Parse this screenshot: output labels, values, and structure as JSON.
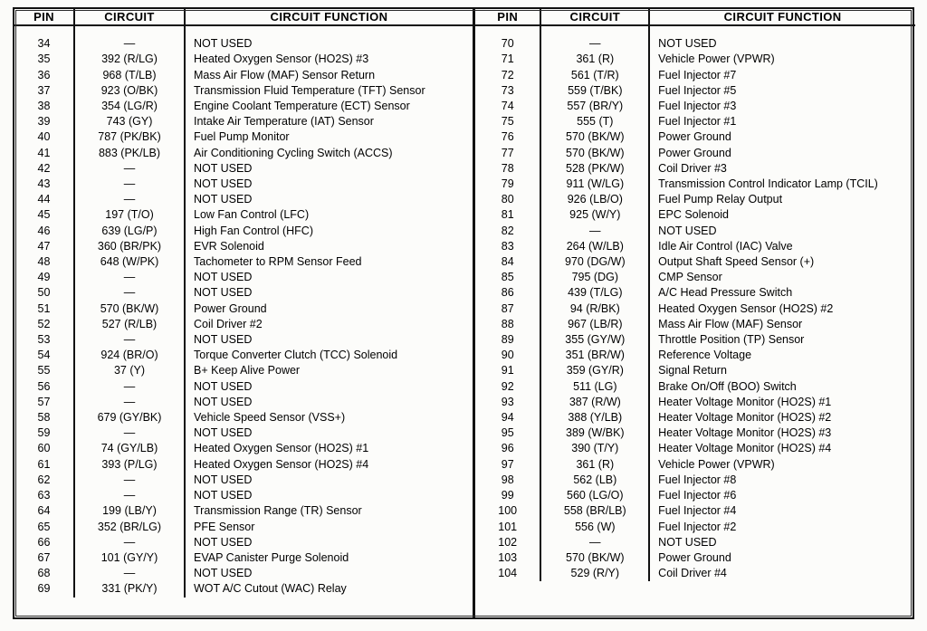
{
  "document": {
    "type": "pcm-connector-pinout-table",
    "columns": [
      "PIN",
      "CIRCUIT",
      "CIRCUIT FUNCTION"
    ],
    "not_used_label": "NOT USED",
    "empty_circuit_symbol": "—"
  },
  "left_table": {
    "headers": {
      "pin": "PIN",
      "circuit": "CIRCUIT",
      "function": "CIRCUIT FUNCTION"
    },
    "rows": [
      {
        "pin": "34",
        "circuit": "—",
        "function": "NOT USED"
      },
      {
        "pin": "35",
        "circuit": "392 (R/LG)",
        "function": "Heated Oxygen Sensor (HO2S) #3"
      },
      {
        "pin": "36",
        "circuit": "968 (T/LB)",
        "function": "Mass Air Flow (MAF) Sensor Return"
      },
      {
        "pin": "37",
        "circuit": "923 (O/BK)",
        "function": "Transmission Fluid Temperature (TFT) Sensor"
      },
      {
        "pin": "38",
        "circuit": "354 (LG/R)",
        "function": "Engine Coolant Temperature (ECT) Sensor"
      },
      {
        "pin": "39",
        "circuit": "743 (GY)",
        "function": "Intake Air Temperature (IAT) Sensor"
      },
      {
        "pin": "40",
        "circuit": "787 (PK/BK)",
        "function": "Fuel Pump Monitor"
      },
      {
        "pin": "41",
        "circuit": "883 (PK/LB)",
        "function": "Air Conditioning Cycling Switch (ACCS)"
      },
      {
        "pin": "42",
        "circuit": "—",
        "function": "NOT USED"
      },
      {
        "pin": "43",
        "circuit": "—",
        "function": "NOT USED"
      },
      {
        "pin": "44",
        "circuit": "—",
        "function": "NOT USED"
      },
      {
        "pin": "45",
        "circuit": "197 (T/O)",
        "function": "Low Fan Control (LFC)"
      },
      {
        "pin": "46",
        "circuit": "639 (LG/P)",
        "function": "High Fan Control (HFC)"
      },
      {
        "pin": "47",
        "circuit": "360 (BR/PK)",
        "function": "EVR Solenoid"
      },
      {
        "pin": "48",
        "circuit": "648 (W/PK)",
        "function": "Tachometer to RPM Sensor Feed"
      },
      {
        "pin": "49",
        "circuit": "—",
        "function": "NOT USED"
      },
      {
        "pin": "50",
        "circuit": "—",
        "function": "NOT USED"
      },
      {
        "pin": "51",
        "circuit": "570 (BK/W)",
        "function": "Power Ground"
      },
      {
        "pin": "52",
        "circuit": "527 (R/LB)",
        "function": "Coil Driver #2"
      },
      {
        "pin": "53",
        "circuit": "—",
        "function": "NOT USED"
      },
      {
        "pin": "54",
        "circuit": "924 (BR/O)",
        "function": "Torque Converter Clutch (TCC) Solenoid"
      },
      {
        "pin": "55",
        "circuit": "37 (Y)",
        "function": "B+ Keep Alive Power"
      },
      {
        "pin": "56",
        "circuit": "—",
        "function": "NOT USED"
      },
      {
        "pin": "57",
        "circuit": "—",
        "function": "NOT USED"
      },
      {
        "pin": "58",
        "circuit": "679 (GY/BK)",
        "function": "Vehicle Speed Sensor (VSS+)"
      },
      {
        "pin": "59",
        "circuit": "—",
        "function": "NOT USED"
      },
      {
        "pin": "60",
        "circuit": "74 (GY/LB)",
        "function": "Heated Oxygen Sensor (HO2S) #1"
      },
      {
        "pin": "61",
        "circuit": "393 (P/LG)",
        "function": "Heated Oxygen Sensor (HO2S) #4"
      },
      {
        "pin": "62",
        "circuit": "—",
        "function": "NOT USED"
      },
      {
        "pin": "63",
        "circuit": "—",
        "function": "NOT USED"
      },
      {
        "pin": "64",
        "circuit": "199 (LB/Y)",
        "function": "Transmission Range (TR) Sensor"
      },
      {
        "pin": "65",
        "circuit": "352 (BR/LG)",
        "function": "PFE Sensor"
      },
      {
        "pin": "66",
        "circuit": "—",
        "function": "NOT USED"
      },
      {
        "pin": "67",
        "circuit": "101 (GY/Y)",
        "function": "EVAP Canister Purge Solenoid"
      },
      {
        "pin": "68",
        "circuit": "—",
        "function": "NOT USED"
      },
      {
        "pin": "69",
        "circuit": "331 (PK/Y)",
        "function": "WOT A/C Cutout (WAC) Relay"
      }
    ]
  },
  "right_table": {
    "headers": {
      "pin": "PIN",
      "circuit": "CIRCUIT",
      "function": "CIRCUIT FUNCTION"
    },
    "rows": [
      {
        "pin": "70",
        "circuit": "—",
        "function": "NOT USED"
      },
      {
        "pin": "71",
        "circuit": "361 (R)",
        "function": "Vehicle Power (VPWR)"
      },
      {
        "pin": "72",
        "circuit": "561 (T/R)",
        "function": "Fuel Injector #7"
      },
      {
        "pin": "73",
        "circuit": "559 (T/BK)",
        "function": "Fuel Injector #5"
      },
      {
        "pin": "74",
        "circuit": "557 (BR/Y)",
        "function": "Fuel Injector #3"
      },
      {
        "pin": "75",
        "circuit": "555 (T)",
        "function": "Fuel Injector #1"
      },
      {
        "pin": "76",
        "circuit": "570 (BK/W)",
        "function": "Power Ground"
      },
      {
        "pin": "77",
        "circuit": "570 (BK/W)",
        "function": "Power Ground"
      },
      {
        "pin": "78",
        "circuit": "528 (PK/W)",
        "function": "Coil Driver #3"
      },
      {
        "pin": "79",
        "circuit": "911 (W/LG)",
        "function": "Transmission Control Indicator Lamp (TCIL)"
      },
      {
        "pin": "80",
        "circuit": "926 (LB/O)",
        "function": "Fuel Pump Relay Output"
      },
      {
        "pin": "81",
        "circuit": "925 (W/Y)",
        "function": "EPC Solenoid"
      },
      {
        "pin": "82",
        "circuit": "—",
        "function": "NOT USED"
      },
      {
        "pin": "83",
        "circuit": "264 (W/LB)",
        "function": "Idle Air Control (IAC) Valve"
      },
      {
        "pin": "84",
        "circuit": "970 (DG/W)",
        "function": "Output Shaft Speed Sensor (+)"
      },
      {
        "pin": "85",
        "circuit": "795 (DG)",
        "function": "CMP Sensor"
      },
      {
        "pin": "86",
        "circuit": "439 (T/LG)",
        "function": "A/C Head Pressure Switch"
      },
      {
        "pin": "87",
        "circuit": "94 (R/BK)",
        "function": "Heated Oxygen Sensor (HO2S) #2"
      },
      {
        "pin": "88",
        "circuit": "967 (LB/R)",
        "function": "Mass Air Flow (MAF) Sensor"
      },
      {
        "pin": "89",
        "circuit": "355 (GY/W)",
        "function": "Throttle Position (TP) Sensor"
      },
      {
        "pin": "90",
        "circuit": "351 (BR/W)",
        "function": "Reference Voltage"
      },
      {
        "pin": "91",
        "circuit": "359 (GY/R)",
        "function": "Signal Return"
      },
      {
        "pin": "92",
        "circuit": "511 (LG)",
        "function": "Brake On/Off (BOO) Switch"
      },
      {
        "pin": "93",
        "circuit": "387 (R/W)",
        "function": "Heater Voltage Monitor (HO2S) #1"
      },
      {
        "pin": "94",
        "circuit": "388 (Y/LB)",
        "function": "Heater Voltage Monitor (HO2S) #2"
      },
      {
        "pin": "95",
        "circuit": "389 (W/BK)",
        "function": "Heater Voltage Monitor (HO2S) #3"
      },
      {
        "pin": "96",
        "circuit": "390 (T/Y)",
        "function": "Heater Voltage Monitor (HO2S) #4"
      },
      {
        "pin": "97",
        "circuit": "361 (R)",
        "function": "Vehicle Power (VPWR)"
      },
      {
        "pin": "98",
        "circuit": "562 (LB)",
        "function": "Fuel Injector #8"
      },
      {
        "pin": "99",
        "circuit": "560 (LG/O)",
        "function": "Fuel Injector #6"
      },
      {
        "pin": "100",
        "circuit": "558 (BR/LB)",
        "function": "Fuel Injector #4"
      },
      {
        "pin": "101",
        "circuit": "556 (W)",
        "function": "Fuel Injector #2"
      },
      {
        "pin": "102",
        "circuit": "—",
        "function": "NOT USED"
      },
      {
        "pin": "103",
        "circuit": "570 (BK/W)",
        "function": "Power Ground"
      },
      {
        "pin": "104",
        "circuit": "529 (R/Y)",
        "function": "Coil Driver #4"
      }
    ]
  },
  "colors": {
    "rule": "#111111",
    "text": "#000000",
    "paper": "#fbfbf9"
  }
}
